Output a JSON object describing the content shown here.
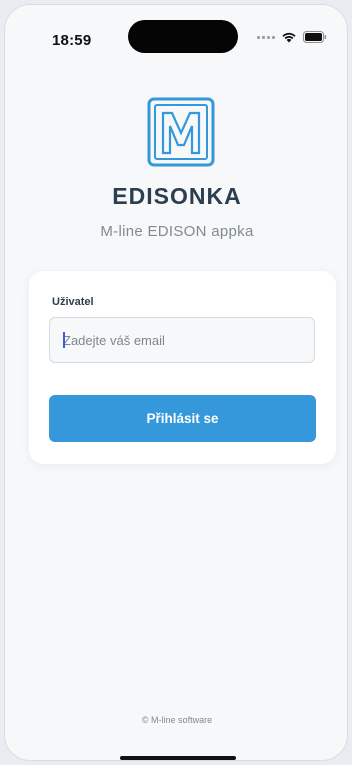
{
  "status_bar": {
    "time": "18:59",
    "icons": [
      "signal-dots-icon",
      "wifi-icon",
      "battery-icon"
    ]
  },
  "logo": {
    "letter": "M",
    "icon": "m-line-logo-icon",
    "color": "#3498db"
  },
  "header": {
    "title": "EDISONKA",
    "subtitle": "M-line EDISON appka"
  },
  "login_form": {
    "user_label": "Uživatel",
    "email_placeholder": "Zadejte váš email",
    "email_value": "",
    "submit_label": "Přihlásit se"
  },
  "footer": {
    "copyright": "© M-line software"
  },
  "colors": {
    "accent": "#3498db",
    "title": "#2c3e50",
    "muted": "#7f8c8d",
    "background": "#f6f8fa"
  }
}
